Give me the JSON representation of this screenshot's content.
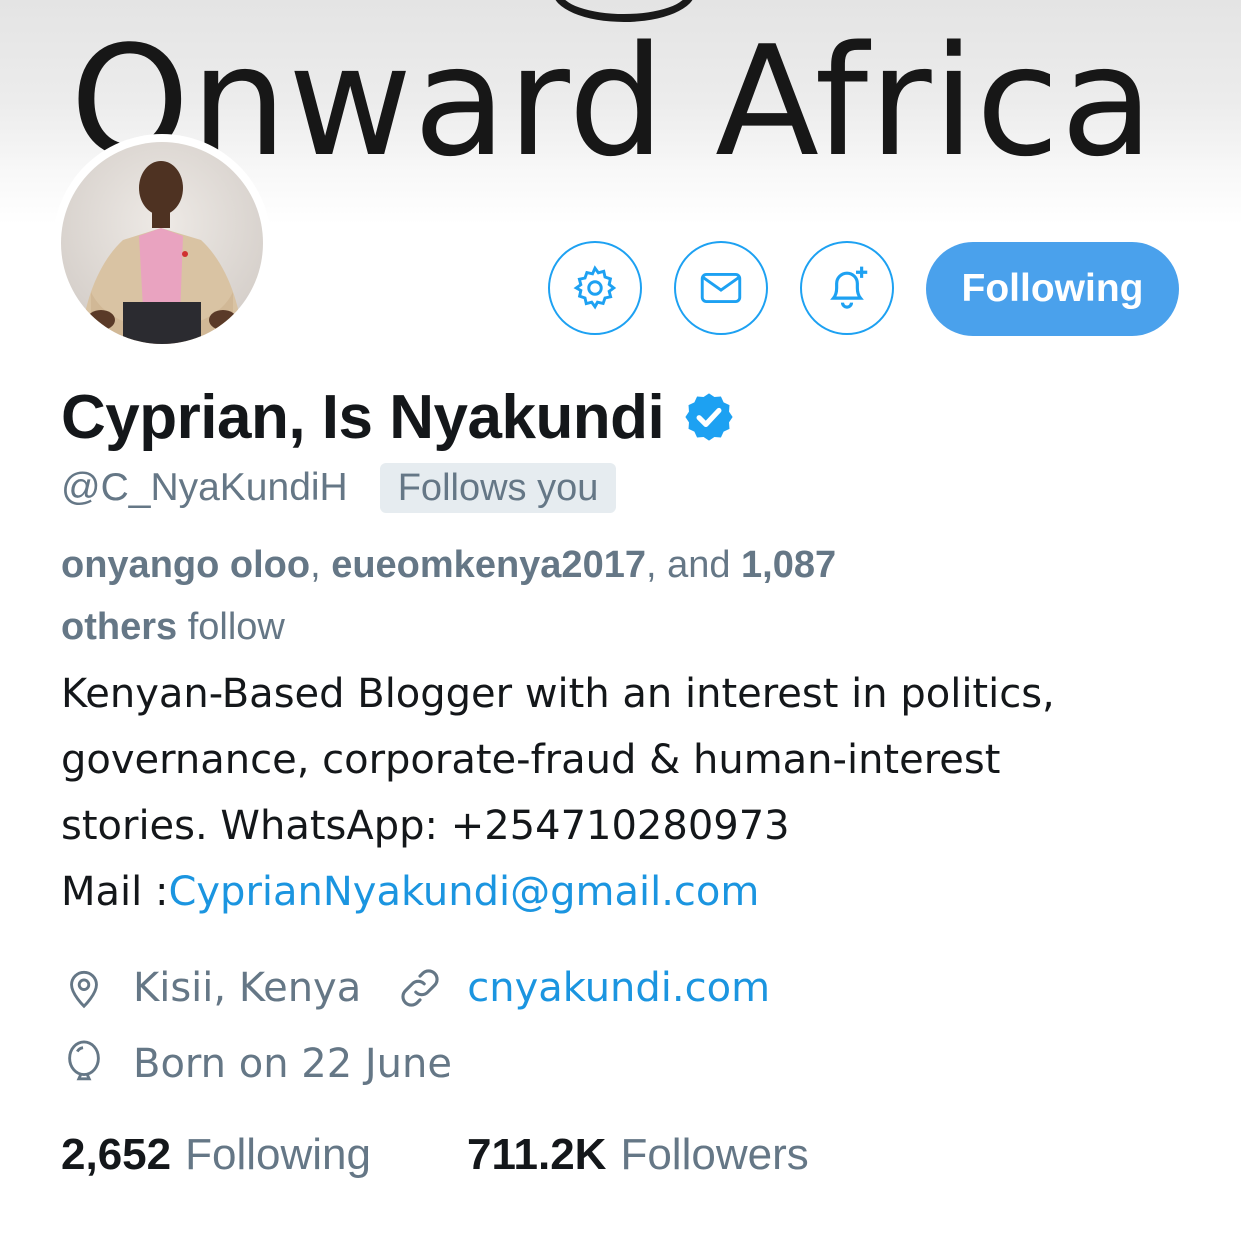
{
  "banner": {
    "text": "Onward Africa"
  },
  "profile": {
    "name": "Cyprian, Is Nyakundi",
    "handle": "@C_NyaKundiH",
    "follows_you": "Follows you"
  },
  "actions": {
    "settings_icon": "gear-icon",
    "message_icon": "envelope-icon",
    "notify_icon": "bell-plus-icon",
    "follow_label": "Following"
  },
  "mutual": {
    "user1": "onyango oloo",
    "sep1": ", ",
    "user2": "eueomkenya2017",
    "sep2": ", and ",
    "count": "1,087",
    "others": "others",
    "suffix": " follow"
  },
  "bio": {
    "line1": "Kenyan-Based Blogger with an interest in politics,",
    "line2": "governance, corporate-fraud & human-interest",
    "line3": "stories. WhatsApp: +254710280973",
    "mail_prefix": "Mail :",
    "mail_link": "CyprianNyakundi@gmail.com"
  },
  "meta": {
    "location": "Kisii, Kenya",
    "website": "cnyakundi.com",
    "birthday": "Born on 22 June"
  },
  "stats": {
    "following_count": "2,652",
    "following_label": "Following",
    "followers_count": "711.2K",
    "followers_label": "Followers"
  },
  "colors": {
    "accent": "#1da1f2",
    "button_fill": "#4aa1ec",
    "link": "#1b95e0",
    "muted": "#657786",
    "text": "#14171a"
  }
}
